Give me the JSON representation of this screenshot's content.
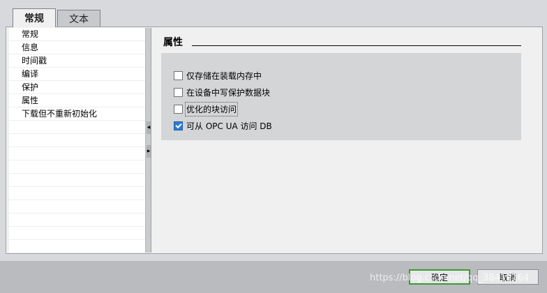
{
  "tabs": [
    {
      "label": "常规",
      "active": true
    },
    {
      "label": "文本",
      "active": false
    }
  ],
  "nav": {
    "items": [
      "常规",
      "信息",
      "时间戳",
      "编译",
      "保护",
      "属性",
      "下载但不重新初始化"
    ],
    "selected": "属性"
  },
  "content": {
    "section_title": "属性",
    "options": [
      {
        "label": "仅存储在装载内存中",
        "checked": false
      },
      {
        "label": "在设备中写保护数据块",
        "checked": false
      },
      {
        "label": "优化的块访问",
        "checked": false
      },
      {
        "label": "可从 OPC UA 访问 DB",
        "checked": true
      }
    ]
  },
  "footer": {
    "ok_label": "确定",
    "cancel_label": "取消"
  },
  "watermark": "https://blog.csdn.net/qq_38419164",
  "colors": {
    "checkbox_checked": "#2e7bd6",
    "ok_border": "#3c9c2e"
  }
}
